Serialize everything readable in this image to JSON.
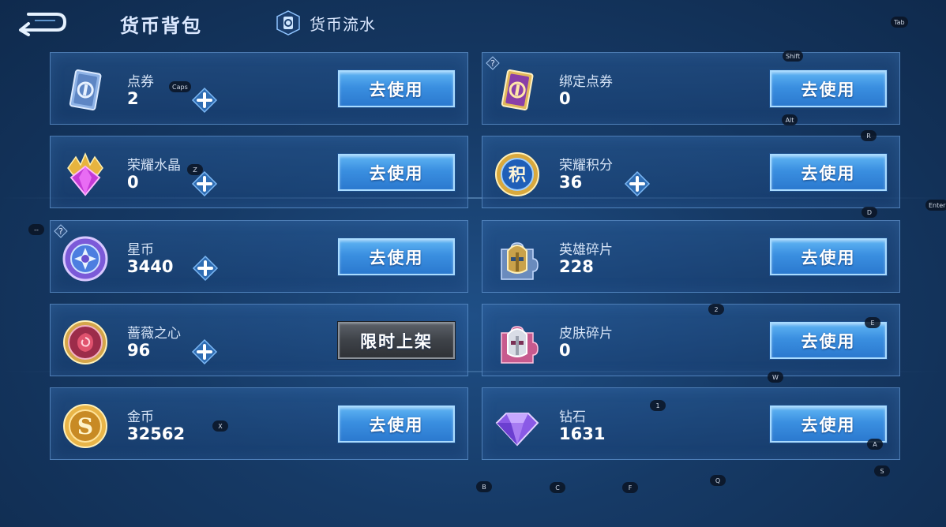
{
  "header": {
    "title": "货币背包",
    "flow_tab_label": "货币流水"
  },
  "buttons": {
    "use": "去使用",
    "limited": "限时上架"
  },
  "currencies": [
    {
      "name": "点券",
      "amount": "2",
      "icon": "ticket-icon"
    },
    {
      "name": "绑定点券",
      "amount": "0",
      "icon": "bound-ticket-icon"
    },
    {
      "name": "荣耀水晶",
      "amount": "0",
      "icon": "glory-crystal-icon"
    },
    {
      "name": "荣耀积分",
      "amount": "36",
      "icon": "glory-points-icon",
      "icon_text": "积"
    },
    {
      "name": "星币",
      "amount": "3440",
      "icon": "star-coin-icon"
    },
    {
      "name": "英雄碎片",
      "amount": "228",
      "icon": "hero-fragment-icon"
    },
    {
      "name": "蔷薇之心",
      "amount": "96",
      "icon": "rose-heart-icon"
    },
    {
      "name": "皮肤碎片",
      "amount": "0",
      "icon": "skin-fragment-icon"
    },
    {
      "name": "金币",
      "amount": "32562",
      "icon": "gold-coin-icon",
      "icon_text": "S"
    },
    {
      "name": "钻石",
      "amount": "1631",
      "icon": "diamond-icon"
    }
  ],
  "key_hints": [
    "Tab",
    "Shift",
    "Caps",
    "Alt",
    "R",
    "Z",
    "D",
    "Enter",
    "--",
    "2",
    "E",
    "W",
    "X",
    "1",
    "A",
    "B",
    "C",
    "F",
    "Q",
    "S"
  ],
  "colors": {
    "background": "#163a66",
    "use_button": "#3a8fe0",
    "limited_button": "#3e4248",
    "card_border": "#78afeb"
  }
}
